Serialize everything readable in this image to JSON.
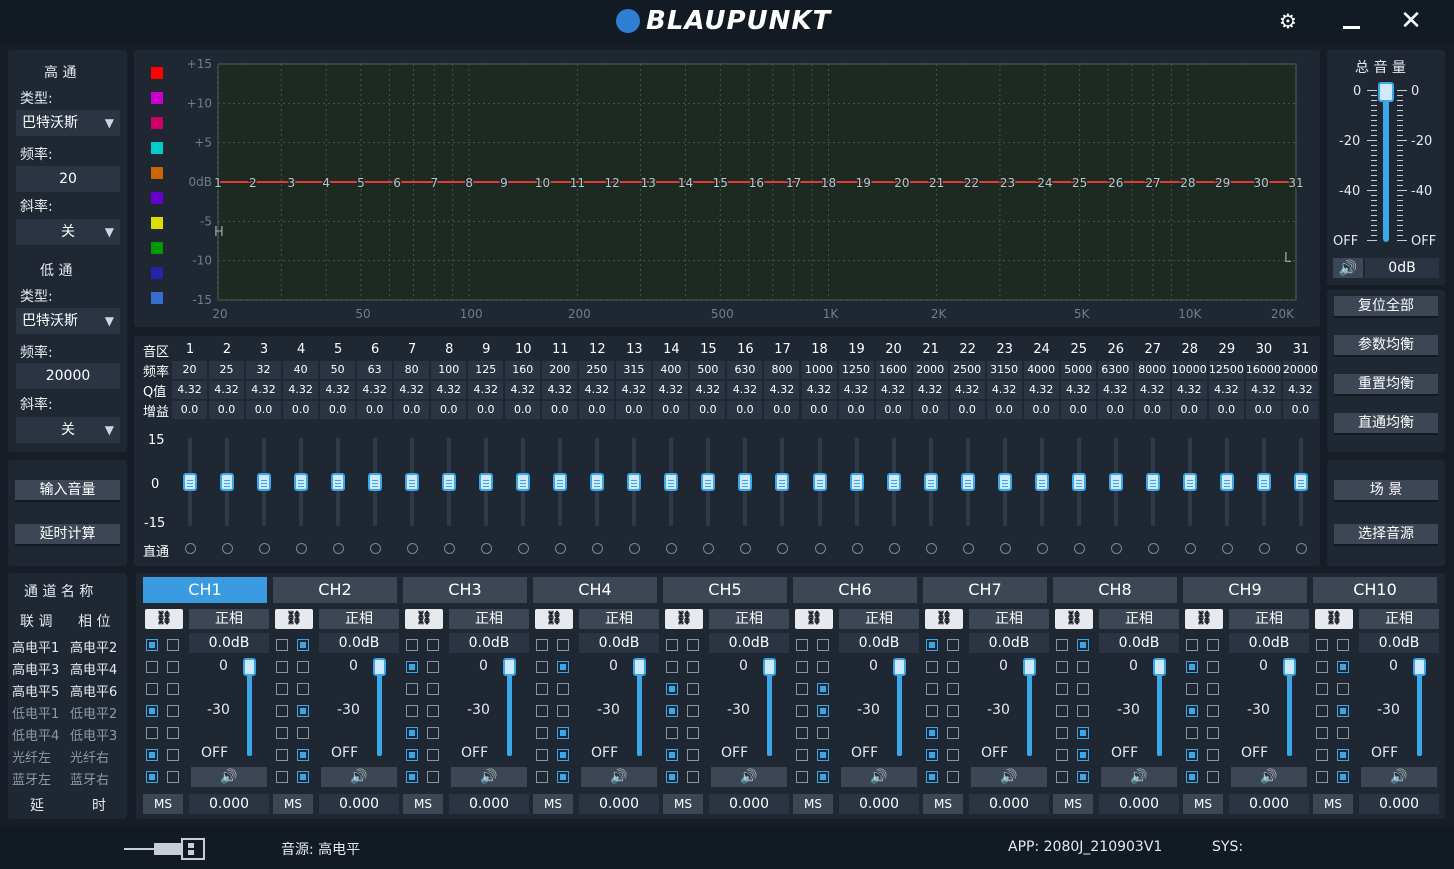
{
  "titlebar": {
    "logo": "BLAUPUNKT",
    "settings_icon": "gear-icon",
    "minimize_icon": "minimize-icon",
    "close_icon": "close-icon"
  },
  "highpass": {
    "title": "高  通",
    "type_label": "类型:",
    "type_value": "巴特沃斯",
    "freq_label": "频率:",
    "freq_value": "20",
    "slope_label": "斜率:",
    "slope_value": "关"
  },
  "lowpass": {
    "title": "低  通",
    "type_label": "类型:",
    "type_value": "巴特沃斯",
    "freq_label": "频率:",
    "freq_value": "20000",
    "slope_label": "斜率:",
    "slope_value": "关"
  },
  "left_buttons": {
    "input_volume": "输入音量",
    "delay_calc": "延时计算"
  },
  "graph": {
    "legend_colors": [
      "#ff0000",
      "#cc00cc",
      "#cc0066",
      "#00cccc",
      "#cc6600",
      "#6600cc",
      "#dddd00",
      "#009900",
      "#2222aa",
      "#3a6bd0"
    ],
    "y_labels": [
      "+15",
      "+10",
      "+5",
      "0dB",
      "-5",
      "-10",
      "-15"
    ],
    "x_labels": [
      "20",
      "50",
      "100",
      "200",
      "500",
      "1K",
      "2K",
      "5K",
      "10K",
      "20K"
    ],
    "band_markers": [
      "1",
      "2",
      "3",
      "4",
      "5",
      "6",
      "7",
      "8",
      "9",
      "10",
      "11",
      "12",
      "13",
      "14",
      "15",
      "16",
      "17",
      "18",
      "19",
      "20",
      "21",
      "22",
      "23",
      "24",
      "25",
      "26",
      "27",
      "28",
      "29",
      "30",
      "31"
    ],
    "hp_marker": "H",
    "lp_marker": "L",
    "curve_color": "#e03a3a"
  },
  "eq": {
    "row_labels": {
      "band": "音区",
      "freq": "频率",
      "q": "Q值",
      "gain": "增益",
      "bypass": "直通"
    },
    "scale": {
      "top": "15",
      "mid": "0",
      "bottom": "-15"
    },
    "bands": [
      "1",
      "2",
      "3",
      "4",
      "5",
      "6",
      "7",
      "8",
      "9",
      "10",
      "11",
      "12",
      "13",
      "14",
      "15",
      "16",
      "17",
      "18",
      "19",
      "20",
      "21",
      "22",
      "23",
      "24",
      "25",
      "26",
      "27",
      "28",
      "29",
      "30",
      "31"
    ],
    "freqs": [
      "20",
      "25",
      "32",
      "40",
      "50",
      "63",
      "80",
      "100",
      "125",
      "160",
      "200",
      "250",
      "315",
      "400",
      "500",
      "630",
      "800",
      "1000",
      "1250",
      "1600",
      "2000",
      "2500",
      "3150",
      "4000",
      "5000",
      "6300",
      "8000",
      "10000",
      "12500",
      "16000",
      "20000"
    ],
    "q": [
      "4.32",
      "4.32",
      "4.32",
      "4.32",
      "4.32",
      "4.32",
      "4.32",
      "4.32",
      "4.32",
      "4.32",
      "4.32",
      "4.32",
      "4.32",
      "4.32",
      "4.32",
      "4.32",
      "4.32",
      "4.32",
      "4.32",
      "4.32",
      "4.32",
      "4.32",
      "4.32",
      "4.32",
      "4.32",
      "4.32",
      "4.32",
      "4.32",
      "4.32",
      "4.32",
      "4.32"
    ],
    "gain": [
      "0.0",
      "0.0",
      "0.0",
      "0.0",
      "0.0",
      "0.0",
      "0.0",
      "0.0",
      "0.0",
      "0.0",
      "0.0",
      "0.0",
      "0.0",
      "0.0",
      "0.0",
      "0.0",
      "0.0",
      "0.0",
      "0.0",
      "0.0",
      "0.0",
      "0.0",
      "0.0",
      "0.0",
      "0.0",
      "0.0",
      "0.0",
      "0.0",
      "0.0",
      "0.0",
      "0.0"
    ]
  },
  "master": {
    "title": "总 音 量",
    "scale_left": [
      "0",
      "-20",
      "-40",
      "OFF"
    ],
    "scale_right": [
      "0",
      "-20",
      "-40",
      "OFF"
    ],
    "value": "0dB",
    "level_fraction": 1.0
  },
  "right_buttons": {
    "reset_all": "复位全部",
    "param_eq": "参数均衡",
    "reset_eq": "重置均衡",
    "flat_eq": "直通均衡",
    "scene": "场  景",
    "select_source": "选择音源"
  },
  "channel_labels": {
    "title": "通 道 名 称",
    "link": "联 调",
    "phase": "相 位",
    "inputs": [
      "高电平1",
      "高电平2",
      "高电平3",
      "高电平4",
      "高电平5",
      "高电平6",
      "低电平1",
      "低电平2",
      "低电平4",
      "低电平3",
      "光纤左",
      "光纤右",
      "蓝牙左",
      "蓝牙右"
    ],
    "delay": "延",
    "delay2": "时"
  },
  "channels": [
    {
      "name": "CH1",
      "phase": "正相",
      "gain": "0.0dB",
      "scale_top": "0",
      "scale_mid": "-30",
      "scale_off": "OFF",
      "ms": "MS",
      "delay": "0.000",
      "checks": [
        [
          1,
          0
        ],
        [
          0,
          0
        ],
        [
          0,
          0
        ],
        [
          1,
          0
        ],
        [
          0,
          0
        ],
        [
          1,
          0
        ],
        [
          1,
          0
        ]
      ],
      "active": true
    },
    {
      "name": "CH2",
      "phase": "正相",
      "gain": "0.0dB",
      "scale_top": "0",
      "scale_mid": "-30",
      "scale_off": "OFF",
      "ms": "MS",
      "delay": "0.000",
      "checks": [
        [
          0,
          1
        ],
        [
          0,
          0
        ],
        [
          0,
          0
        ],
        [
          0,
          1
        ],
        [
          0,
          0
        ],
        [
          0,
          1
        ],
        [
          0,
          1
        ]
      ]
    },
    {
      "name": "CH3",
      "phase": "正相",
      "gain": "0.0dB",
      "scale_top": "0",
      "scale_mid": "-30",
      "scale_off": "OFF",
      "ms": "MS",
      "delay": "0.000",
      "checks": [
        [
          0,
          0
        ],
        [
          1,
          0
        ],
        [
          0,
          0
        ],
        [
          0,
          0
        ],
        [
          1,
          0
        ],
        [
          1,
          0
        ],
        [
          1,
          0
        ]
      ]
    },
    {
      "name": "CH4",
      "phase": "正相",
      "gain": "0.0dB",
      "scale_top": "0",
      "scale_mid": "-30",
      "scale_off": "OFF",
      "ms": "MS",
      "delay": "0.000",
      "checks": [
        [
          0,
          0
        ],
        [
          0,
          1
        ],
        [
          0,
          0
        ],
        [
          0,
          0
        ],
        [
          0,
          1
        ],
        [
          0,
          1
        ],
        [
          0,
          1
        ]
      ]
    },
    {
      "name": "CH5",
      "phase": "正相",
      "gain": "0.0dB",
      "scale_top": "0",
      "scale_mid": "-30",
      "scale_off": "OFF",
      "ms": "MS",
      "delay": "0.000",
      "checks": [
        [
          0,
          0
        ],
        [
          0,
          0
        ],
        [
          1,
          0
        ],
        [
          1,
          0
        ],
        [
          0,
          0
        ],
        [
          1,
          0
        ],
        [
          1,
          0
        ]
      ]
    },
    {
      "name": "CH6",
      "phase": "正相",
      "gain": "0.0dB",
      "scale_top": "0",
      "scale_mid": "-30",
      "scale_off": "OFF",
      "ms": "MS",
      "delay": "0.000",
      "checks": [
        [
          0,
          0
        ],
        [
          0,
          0
        ],
        [
          0,
          1
        ],
        [
          0,
          1
        ],
        [
          0,
          0
        ],
        [
          0,
          1
        ],
        [
          0,
          1
        ]
      ]
    },
    {
      "name": "CH7",
      "phase": "正相",
      "gain": "0.0dB",
      "scale_top": "0",
      "scale_mid": "-30",
      "scale_off": "OFF",
      "ms": "MS",
      "delay": "0.000",
      "checks": [
        [
          1,
          0
        ],
        [
          0,
          0
        ],
        [
          0,
          0
        ],
        [
          0,
          0
        ],
        [
          1,
          0
        ],
        [
          1,
          0
        ],
        [
          1,
          0
        ]
      ]
    },
    {
      "name": "CH8",
      "phase": "正相",
      "gain": "0.0dB",
      "scale_top": "0",
      "scale_mid": "-30",
      "scale_off": "OFF",
      "ms": "MS",
      "delay": "0.000",
      "checks": [
        [
          0,
          1
        ],
        [
          0,
          0
        ],
        [
          0,
          0
        ],
        [
          0,
          0
        ],
        [
          0,
          1
        ],
        [
          0,
          1
        ],
        [
          0,
          1
        ]
      ]
    },
    {
      "name": "CH9",
      "phase": "正相",
      "gain": "0.0dB",
      "scale_top": "0",
      "scale_mid": "-30",
      "scale_off": "OFF",
      "ms": "MS",
      "delay": "0.000",
      "checks": [
        [
          0,
          0
        ],
        [
          1,
          0
        ],
        [
          0,
          0
        ],
        [
          1,
          0
        ],
        [
          0,
          0
        ],
        [
          1,
          0
        ],
        [
          1,
          0
        ]
      ]
    },
    {
      "name": "CH10",
      "phase": "正相",
      "gain": "0.0dB",
      "scale_top": "0",
      "scale_mid": "-30",
      "scale_off": "OFF",
      "ms": "MS",
      "delay": "0.000",
      "checks": [
        [
          0,
          0
        ],
        [
          0,
          1
        ],
        [
          0,
          0
        ],
        [
          0,
          1
        ],
        [
          0,
          0
        ],
        [
          0,
          1
        ],
        [
          0,
          1
        ]
      ]
    }
  ],
  "statusbar": {
    "usb_icon": "usb-icon",
    "source": "音源: 高电平",
    "app": "APP: 2080J_210903V1",
    "sys": "SYS:"
  }
}
